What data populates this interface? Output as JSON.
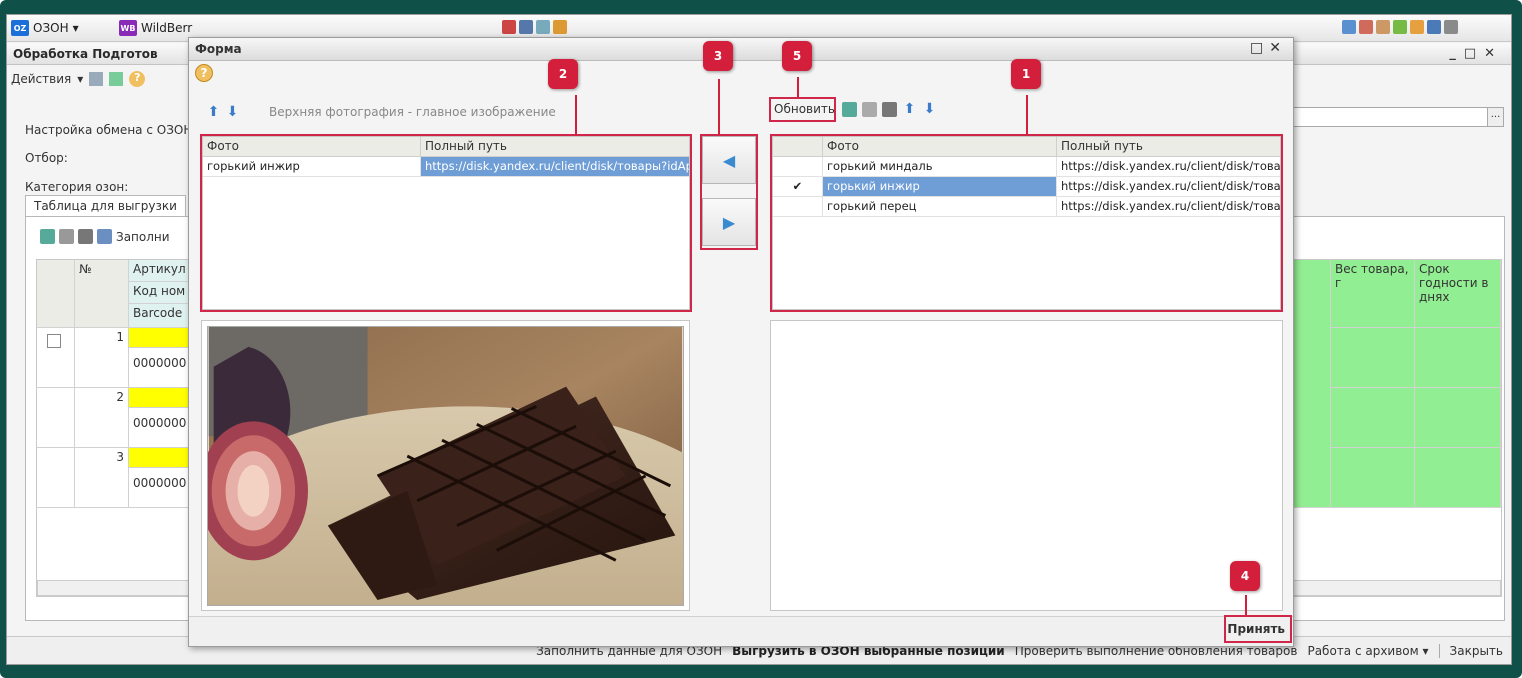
{
  "toolbar": {
    "ozon_label": "ОЗОН",
    "wb_badge": "WB",
    "wb_label": "WildBerr"
  },
  "bgwindow": {
    "title": "Обработка Подготов",
    "actions_label": "Действия",
    "settings_label": "Настройка обмена с ОЗОН",
    "filter_label": "Отбор:",
    "category_label": "Категория озон:",
    "tab_label": "Таблица для выгрузки",
    "fill_label": "Заполни",
    "columns": {
      "num": "№",
      "article": "Артикул",
      "code": "Код ном",
      "barcode": "Barcode",
      "weight": "Вес товара, г",
      "shelf_life": "Срок годности в днях"
    },
    "rows": [
      {
        "num": "1",
        "code": "0000000"
      },
      {
        "num": "2",
        "code": "0000000"
      },
      {
        "num": "3",
        "code": "0000000"
      }
    ],
    "footer": {
      "fill": "Заполнить данные для ОЗОН",
      "upload": "Выгрузить в ОЗОН выбранные позиции",
      "check": "Проверить выполнение обновления товаров",
      "archive": "Работа с архивом",
      "close": "Закрыть"
    }
  },
  "modal": {
    "title": "Форма",
    "left_caption": "Верхняя фотография - главное изображение",
    "left_table": {
      "headers": [
        "Фото",
        "Полный путь"
      ],
      "rows": [
        {
          "photo": "горький инжир",
          "path": "https://disk.yandex.ru/client/disk/товары?idAp..."
        }
      ]
    },
    "right_toolbar": {
      "refresh": "Обновить"
    },
    "right_table": {
      "headers": [
        "",
        "Фото",
        "Полный путь"
      ],
      "rows": [
        {
          "check": "",
          "photo": "горький миндаль",
          "path": "https://disk.yandex.ru/client/disk/това..."
        },
        {
          "check": "✔",
          "photo": "горький инжир",
          "path": "https://disk.yandex.ru/client/disk/това..."
        },
        {
          "check": "",
          "photo": "горький перец",
          "path": "https://disk.yandex.ru/client/disk/това..."
        }
      ]
    },
    "accept": "Принять"
  },
  "callouts": [
    "1",
    "2",
    "3",
    "4",
    "5"
  ],
  "colors": {
    "callout": "#d41f3c",
    "selection": "#6f9dd6",
    "highlight_yellow": "#ffff00",
    "highlight_green": "#92ee92"
  }
}
